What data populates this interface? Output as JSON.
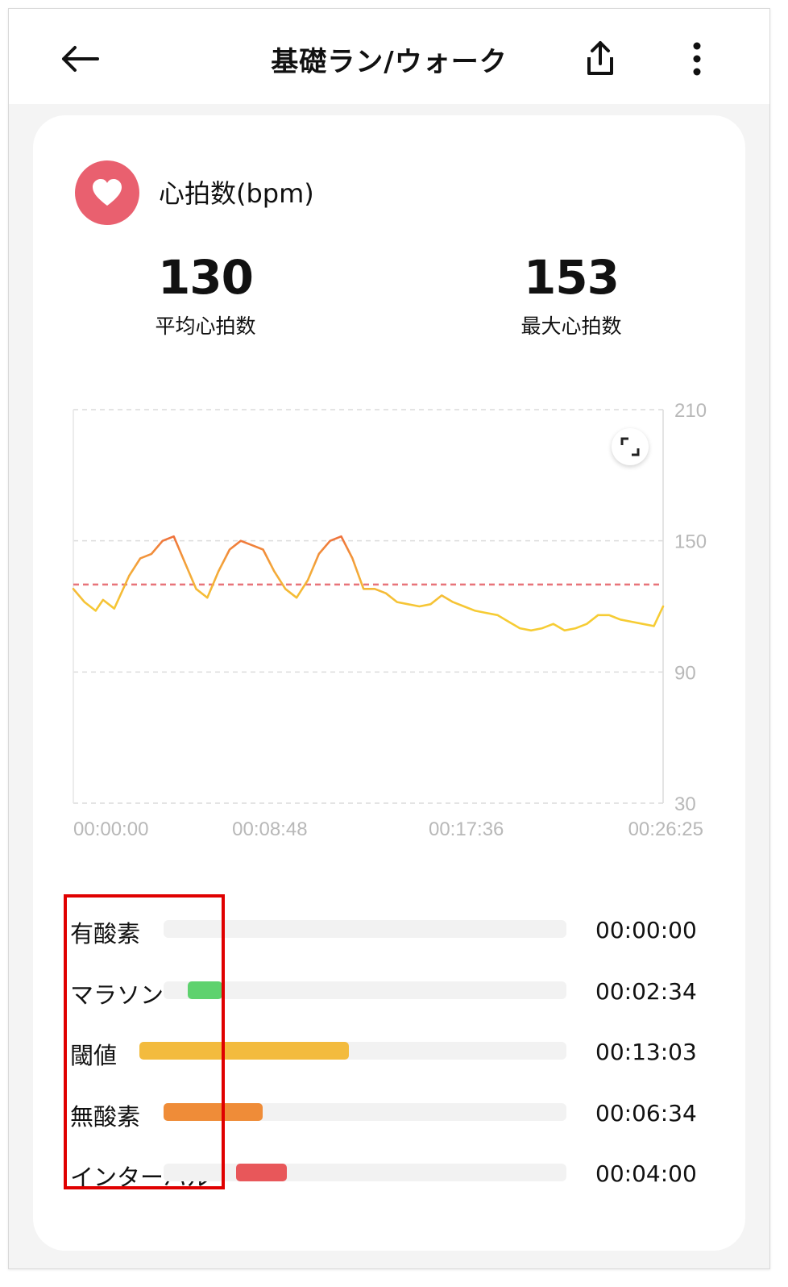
{
  "header": {
    "title": "基礎ラン/ウォーク"
  },
  "card": {
    "title": "心拍数(bpm)",
    "avg": {
      "value": "130",
      "label": "平均心拍数"
    },
    "max": {
      "value": "153",
      "label": "最大心拍数"
    }
  },
  "chart_data": {
    "type": "line",
    "y_ticks": [
      "210",
      "150",
      "90",
      "30"
    ],
    "x_ticks": [
      "00:00:00",
      "00:08:48",
      "00:17:36",
      "00:26:25"
    ],
    "ylim": [
      30,
      210
    ],
    "xlim_seconds": [
      0,
      1585
    ],
    "grid": true,
    "avg_line": 130,
    "series": [
      {
        "x": [
          0,
          30,
          60,
          80,
          110,
          150,
          180,
          210,
          240,
          270,
          300,
          330,
          360,
          390,
          420,
          450,
          480,
          510,
          540,
          570,
          600,
          630,
          660,
          690,
          720,
          750,
          780,
          810,
          840,
          870,
          900,
          930,
          960,
          990,
          1020,
          1050,
          1080,
          1110,
          1140,
          1170,
          1200,
          1230,
          1260,
          1290,
          1320,
          1350,
          1380,
          1410,
          1440,
          1470,
          1500,
          1530,
          1560,
          1585
        ],
        "y": [
          128,
          122,
          118,
          123,
          119,
          134,
          142,
          144,
          150,
          152,
          140,
          128,
          124,
          136,
          146,
          150,
          148,
          146,
          136,
          128,
          124,
          132,
          144,
          150,
          152,
          142,
          128,
          128,
          126,
          122,
          121,
          120,
          121,
          125,
          122,
          120,
          118,
          117,
          116,
          113,
          110,
          109,
          110,
          112,
          109,
          110,
          112,
          116,
          116,
          114,
          113,
          112,
          111,
          120
        ]
      }
    ]
  },
  "zones": [
    {
      "label": "有酸素",
      "time": "00:00:00",
      "start": 0.0,
      "fraction": 0.0,
      "color": "#e6e6e6"
    },
    {
      "label": "マラソン",
      "time": "00:02:34",
      "start": 0.06,
      "fraction": 0.085,
      "color": "#5ed26e"
    },
    {
      "label": "閾値",
      "time": "00:13:03",
      "start": -0.06,
      "fraction": 0.52,
      "color": "#f3bb3e"
    },
    {
      "label": "無酸素",
      "time": "00:06:34",
      "start": 0.0,
      "fraction": 0.245,
      "color": "#ef8c38"
    },
    {
      "label": "インターバル",
      "time": "00:04:00",
      "start": 0.18,
      "fraction": 0.125,
      "color": "#e8575a"
    }
  ]
}
